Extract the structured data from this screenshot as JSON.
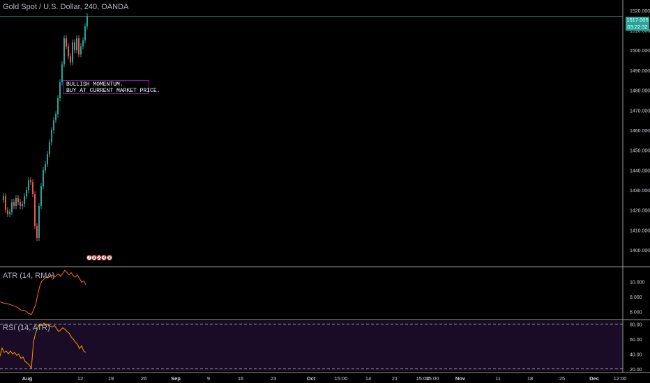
{
  "header": {
    "title": "Gold Spot / U.S. Dollar, 240, OANDA"
  },
  "annotation": {
    "line1": "BULLISH MOMENTUM.",
    "line2": "BUY AT CURRENT MARKET PRICE."
  },
  "price_label": {
    "price": "1517.005",
    "countdown": "03:22:32"
  },
  "events": [
    "7",
    "8",
    "10",
    "4",
    "8"
  ],
  "colors": {
    "up": "#26a69a",
    "down": "#ef5350",
    "atr_line": "#ff6d00",
    "rsi_line": "#ff9800",
    "rsi_bg": "#1a0b26",
    "badge": "#26a69a",
    "annotation_border": "#7b1fa2"
  },
  "chart_data": [
    {
      "type": "candlestick",
      "title": "Gold Spot / U.S. Dollar, 240, OANDA",
      "y_axis_ticks": [
        "1520.000",
        "1510.000",
        "1500.000",
        "1490.000",
        "1480.000",
        "1470.000",
        "1460.000",
        "1450.000",
        "1440.000",
        "1430.000",
        "1420.000",
        "1410.000",
        "1400.000"
      ],
      "ylim": [
        1392,
        1521
      ],
      "close_path": [
        [
          0,
          1425
        ],
        [
          3,
          1427
        ],
        [
          6,
          1420
        ],
        [
          9,
          1418
        ],
        [
          12,
          1419
        ],
        [
          15,
          1424
        ],
        [
          18,
          1422
        ],
        [
          21,
          1426
        ],
        [
          24,
          1424
        ],
        [
          27,
          1422
        ],
        [
          30,
          1423
        ],
        [
          33,
          1427
        ],
        [
          36,
          1430
        ],
        [
          39,
          1435
        ],
        [
          42,
          1434
        ],
        [
          45,
          1428
        ],
        [
          48,
          1412
        ],
        [
          51,
          1406
        ],
        [
          54,
          1422
        ],
        [
          57,
          1432
        ],
        [
          60,
          1440
        ],
        [
          63,
          1443
        ],
        [
          66,
          1448
        ],
        [
          69,
          1454
        ],
        [
          72,
          1460
        ],
        [
          75,
          1465
        ],
        [
          78,
          1468
        ],
        [
          81,
          1476
        ],
        [
          84,
          1484
        ],
        [
          87,
          1493
        ],
        [
          90,
          1506
        ],
        [
          93,
          1502
        ],
        [
          96,
          1497
        ],
        [
          99,
          1494
        ],
        [
          102,
          1504
        ],
        [
          105,
          1500
        ],
        [
          108,
          1506
        ],
        [
          111,
          1498
        ],
        [
          114,
          1502
        ],
        [
          117,
          1505
        ],
        [
          120,
          1512
        ],
        [
          123,
          1517
        ]
      ],
      "last_price": 1517.005
    },
    {
      "type": "line",
      "series": [
        {
          "name": "ATR (14, RMA)"
        }
      ],
      "y_axis_ticks": [
        "10.000",
        "8.000",
        "6.000"
      ],
      "ylim": [
        5,
        11.8
      ],
      "values_path": [
        [
          0,
          7.3
        ],
        [
          6,
          7.1
        ],
        [
          12,
          7.0
        ],
        [
          18,
          6.8
        ],
        [
          24,
          6.6
        ],
        [
          30,
          6.2
        ],
        [
          36,
          6.1
        ],
        [
          42,
          5.7
        ],
        [
          45,
          5.6
        ],
        [
          48,
          6.2
        ],
        [
          51,
          6.9
        ],
        [
          54,
          8.2
        ],
        [
          57,
          9.4
        ],
        [
          60,
          10.1
        ],
        [
          63,
          10.3
        ],
        [
          66,
          10.6
        ],
        [
          69,
          10.5
        ],
        [
          72,
          10.7
        ],
        [
          75,
          10.9
        ],
        [
          78,
          10.6
        ],
        [
          81,
          10.8
        ],
        [
          84,
          11.0
        ],
        [
          87,
          10.7
        ],
        [
          90,
          11.1
        ],
        [
          93,
          11.5
        ],
        [
          96,
          11.2
        ],
        [
          99,
          10.9
        ],
        [
          102,
          11.2
        ],
        [
          105,
          10.8
        ],
        [
          108,
          10.6
        ],
        [
          111,
          10.9
        ],
        [
          114,
          10.4
        ],
        [
          117,
          9.9
        ],
        [
          120,
          10.1
        ],
        [
          123,
          9.6
        ]
      ]
    },
    {
      "type": "line",
      "series": [
        {
          "name": "RSI (14, ATR)"
        }
      ],
      "y_axis_ticks": [
        "80.00",
        "60.00",
        "40.00",
        "20.00"
      ],
      "ylim": [
        17,
        84
      ],
      "bands": [
        80,
        20
      ],
      "values_path": [
        [
          0,
          37
        ],
        [
          3,
          48
        ],
        [
          6,
          42
        ],
        [
          9,
          44
        ],
        [
          12,
          40
        ],
        [
          15,
          44
        ],
        [
          18,
          40
        ],
        [
          21,
          42
        ],
        [
          24,
          38
        ],
        [
          27,
          40
        ],
        [
          30,
          34
        ],
        [
          33,
          36
        ],
        [
          36,
          30
        ],
        [
          39,
          28
        ],
        [
          42,
          25
        ],
        [
          45,
          21
        ],
        [
          48,
          56
        ],
        [
          51,
          68
        ],
        [
          54,
          75
        ],
        [
          57,
          80
        ],
        [
          60,
          78
        ],
        [
          63,
          81
        ],
        [
          66,
          79
        ],
        [
          69,
          80
        ],
        [
          72,
          77
        ],
        [
          75,
          76
        ],
        [
          78,
          78
        ],
        [
          81,
          74
        ],
        [
          84,
          70
        ],
        [
          87,
          72
        ],
        [
          90,
          75
        ],
        [
          93,
          73
        ],
        [
          96,
          70
        ],
        [
          99,
          68
        ],
        [
          102,
          63
        ],
        [
          105,
          60
        ],
        [
          108,
          56
        ],
        [
          111,
          53
        ],
        [
          114,
          47
        ],
        [
          117,
          51
        ],
        [
          120,
          44
        ],
        [
          123,
          42
        ]
      ]
    }
  ],
  "x_axis": {
    "labels": [
      {
        "text": "Aug",
        "bold": true
      },
      {
        "text": "12"
      },
      {
        "text": "19"
      },
      {
        "text": "26"
      },
      {
        "text": "Sep",
        "bold": true
      },
      {
        "text": "9"
      },
      {
        "text": "16"
      },
      {
        "text": "23"
      },
      {
        "text": "Oct",
        "bold": true
      },
      {
        "text": "15:00"
      },
      {
        "text": "14"
      },
      {
        "text": "21"
      },
      {
        "text": "15:00"
      },
      {
        "text": "15:00"
      },
      {
        "text": "Nov",
        "bold": true
      },
      {
        "text": "11"
      },
      {
        "text": "18"
      },
      {
        "text": "25"
      },
      {
        "text": "Dec",
        "bold": true
      },
      {
        "text": "12:00"
      }
    ]
  }
}
